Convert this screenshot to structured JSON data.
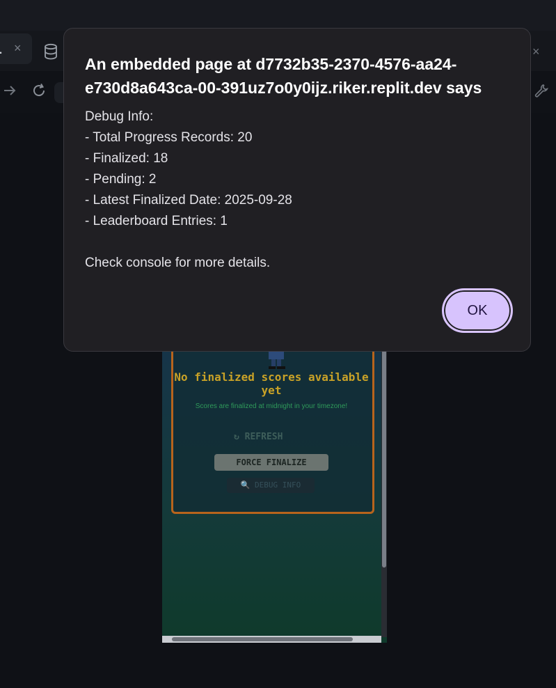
{
  "browser": {
    "tab_title_fragment": ".",
    "tab_close": "×",
    "far_close": "×"
  },
  "app_preview": {
    "empty_title": "No finalized scores available yet",
    "empty_subtitle": "Scores are finalized at midnight in your timezone!",
    "refresh_label": "↻ REFRESH",
    "force_finalize_label": "FORCE FINALIZE",
    "debug_info_label": "🔍 DEBUG INFO"
  },
  "dialog": {
    "title": "An embedded page at d7732b35-2370-4576-aa24-e730d8a643ca-00-391uz7o0y0ijz.riker.replit.dev says",
    "lines": [
      "Debug Info:",
      "- Total Progress Records: 20",
      "- Finalized: 18",
      "- Pending: 2",
      "- Latest Finalized Date: 2025-09-28",
      "- Leaderboard Entries: 1",
      "",
      "Check console for more details."
    ],
    "ok_label": "OK"
  }
}
